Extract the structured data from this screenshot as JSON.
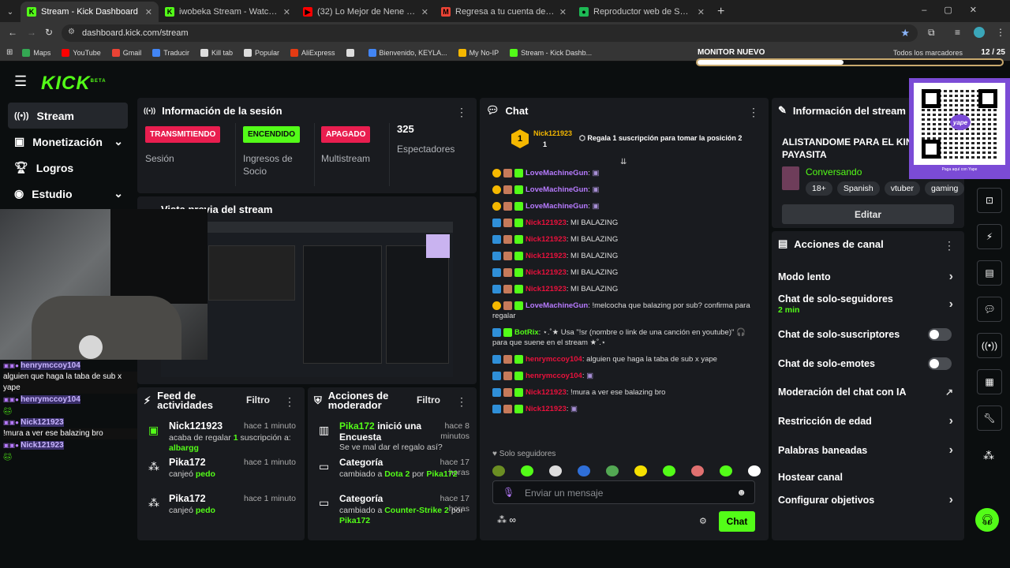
{
  "browser": {
    "tabs": [
      {
        "title": "Stream - Kick Dashboard",
        "color": "#53fc18",
        "letter": "K"
      },
      {
        "title": "iwobeka Stream - Watch Live o",
        "color": "#53fc18",
        "letter": "K"
      },
      {
        "title": "(32) Lo Mejor de Nene Malo En",
        "color": "#ff0000",
        "letter": "▶"
      },
      {
        "title": "Regresa a tu cuenta de Spotify",
        "color": "#ea4335",
        "letter": "M"
      },
      {
        "title": "Reproductor web de Spotify: m",
        "color": "#1db954",
        "letter": "●"
      }
    ],
    "url": "dashboard.kick.com/stream",
    "bookmarks": [
      "Maps",
      "YouTube",
      "Gmail",
      "Traducir",
      "Kill tab",
      "Popular",
      "AliExpress",
      "",
      "Bienvenido, KEYLA...",
      "My No-IP",
      "Stream - Kick Dashb..."
    ],
    "bookmarks_right": "Todos los marcadores"
  },
  "overlay": {
    "monitor_title": "MONITOR NUEVO",
    "monitor_count": "12 / 25",
    "monitor_progress": 0.48,
    "chat": [
      {
        "user": "henrymccoy104",
        "text": "alguien que haga la taba de sub x yape"
      },
      {
        "user": "henrymccoy104",
        "text": ""
      },
      {
        "user": "Nick121923",
        "text": "!mura a ver ese balazing bro"
      },
      {
        "user": "Nick121923",
        "text": ""
      }
    ]
  },
  "sidebar": {
    "items": [
      {
        "label": "Stream",
        "icon": "broadcast-icon",
        "active": true
      },
      {
        "label": "Monetización",
        "icon": "money-icon"
      },
      {
        "label": "Logros",
        "icon": "trophy-icon"
      },
      {
        "label": "Estudio",
        "icon": "studio-icon"
      }
    ]
  },
  "session": {
    "title": "Información de la sesión",
    "stats": [
      {
        "badge": "TRANSMITIENDO",
        "label": "Sesión",
        "color": "#e91e4f"
      },
      {
        "badge": "ENCENDIDO",
        "label": "Ingresos de Socio",
        "color": "#53fc18"
      },
      {
        "badge": "APAGADO",
        "label": "Multistream",
        "color": "#e91e4f"
      },
      {
        "badge": "325",
        "label": "Espectadores",
        "color": ""
      }
    ]
  },
  "preview": {
    "title": "Vista previa del stream"
  },
  "feed": {
    "title": "Feed de actividades",
    "filter": "Filtro",
    "items": [
      {
        "user": "Nick121923",
        "time": "hace 1 minuto",
        "text": "acaba de regalar",
        "count": "1",
        "text2": "suscripción a:",
        "target": "albargg"
      },
      {
        "user": "Pika172",
        "time": "hace 1 minuto",
        "text": "canjeó",
        "target": "pedo"
      },
      {
        "user": "Pika172",
        "time": "hace 1 minuto",
        "text": "canjeó",
        "target": "pedo"
      }
    ]
  },
  "mod": {
    "title": "Acciones de moderador",
    "filter": "Filtro",
    "items": [
      {
        "user": "Pika172",
        "action": "inició una Encuesta",
        "time": "hace 8 minutos",
        "detail": "Se ve mal dar el regalo así?"
      },
      {
        "user": "Categoría",
        "action": "",
        "time": "hace 17 horas",
        "detail": "cambiado a",
        "value": "Dota 2",
        "by": "por",
        "who": "Pika172"
      },
      {
        "user": "Categoría",
        "action": "",
        "time": "hace 17 horas",
        "detail": "cambiado a",
        "value": "Counter-Strike 2",
        "by": "por",
        "who": "Pika172"
      }
    ]
  },
  "chat": {
    "title": "Chat",
    "top_user": "Nick121923",
    "top_count": "1",
    "gift_promo": "Regala 1 suscripción para tomar la posición 2",
    "messages": [
      {
        "user": "LoveMachineGun",
        "text": ":",
        "color": "#b77bff"
      },
      {
        "user": "LoveMachineGun",
        "text": ":",
        "color": "#b77bff"
      },
      {
        "user": "LoveMachineGun",
        "text": ":",
        "color": "#b77bff"
      },
      {
        "user": "Nick121923",
        "text": ": MI BALAZING",
        "color": "#e9113c"
      },
      {
        "user": "Nick121923",
        "text": ": MI BALAZING",
        "color": "#e9113c"
      },
      {
        "user": "Nick121923",
        "text": ": MI BALAZING",
        "color": "#e9113c"
      },
      {
        "user": "Nick121923",
        "text": ": MI BALAZING",
        "color": "#e9113c"
      },
      {
        "user": "Nick121923",
        "text": ": MI BALAZING",
        "color": "#e9113c"
      },
      {
        "user": "LoveMachineGun",
        "text": ": !melcocha que balazing por sub? confirma para regalar",
        "color": "#b77bff"
      },
      {
        "user": "BotRix",
        "text": ": ⋆.˚★ Usa \"!sr (nombre o link de una canción en youtube)\" 🎧 para que suene en el stream ★˚.⋆",
        "color": "#53fc18"
      },
      {
        "user": "henrymccoy104",
        "text": ": alguien que haga la taba de sub x yape",
        "color": "#e9113c"
      },
      {
        "user": "henrymccoy104",
        "text": ":",
        "color": "#e9113c"
      },
      {
        "user": "Nick121923",
        "text": ": !mura a ver ese balazing bro",
        "color": "#e9113c"
      },
      {
        "user": "Nick121923",
        "text": ":",
        "color": "#e9113c"
      }
    ],
    "mode": "Solo seguidores",
    "input_placeholder": "Enviar un mensaje",
    "send_label": "Chat"
  },
  "stream_info": {
    "title": "Información del stream",
    "stream_title": "ALISTANDOME PARA EL KING PAYASITA",
    "category": "Conversando",
    "tags": [
      "18+",
      "Spanish",
      "vtuber",
      "gaming"
    ],
    "edit_label": "Editar"
  },
  "channel_actions": {
    "title": "Acciones de canal",
    "rows": [
      {
        "label": "Modo lento",
        "type": "chev"
      },
      {
        "label": "Chat de solo-seguidores",
        "sub": "2 min",
        "type": "chev"
      },
      {
        "label": "Chat de solo-suscriptores",
        "type": "toggle"
      },
      {
        "label": "Chat de solo-emotes",
        "type": "toggle"
      },
      {
        "label": "Moderación del chat con IA",
        "type": "ext"
      },
      {
        "label": "Restricción de edad",
        "type": "chev"
      },
      {
        "label": "Palabras baneadas",
        "type": "chev"
      },
      {
        "label": "Hostear canal",
        "type": "none"
      },
      {
        "label": "Configurar objetivos",
        "type": "chev"
      }
    ]
  },
  "qr": {
    "caption": "Paga aquí con Yape"
  },
  "colors": {
    "accent": "#53fc18",
    "live": "#e91e4f",
    "panel": "#191b1f"
  }
}
